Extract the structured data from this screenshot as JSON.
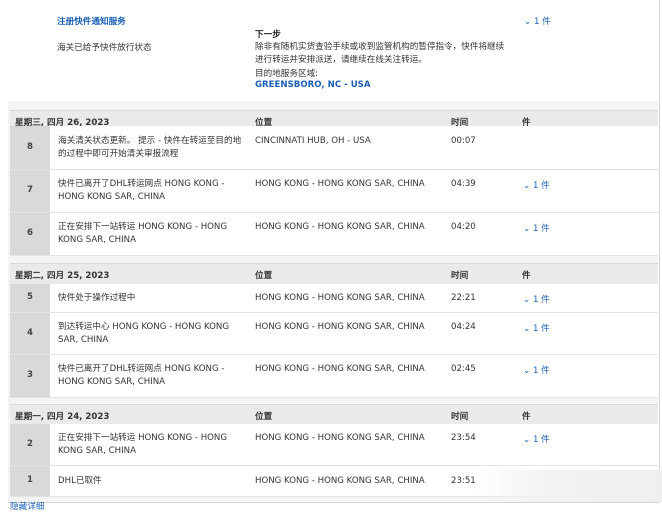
{
  "top": {
    "register_link": "注册快件通知服务",
    "pieces_toggle": "1 件",
    "status_text": "海关已给予快件放行状态",
    "next_step_title": "下一步",
    "next_step_body": "除非有随机实货查验手续或收到监管机构的暂停指令，快件将继续进行转运并安排派送，请继续在线关注转运。",
    "destination_label": "目的地服务区域:",
    "destination_value": "GREENSBORO, NC - USA"
  },
  "columns": {
    "location": "位置",
    "time": "时间",
    "pieces": "件"
  },
  "days": [
    {
      "date": "星期三, 四月 26, 2023",
      "events": [
        {
          "n": "8",
          "desc": "海关清关状态更新。 提示 - 快件在转运至目的地的过程中即可开始清关审报流程",
          "loc": "CINCINNATI HUB, OH - USA",
          "time": "00:07",
          "pcs": ""
        },
        {
          "n": "7",
          "desc": "快件已离开了DHL转运网点 HONG KONG - HONG KONG SAR, CHINA",
          "loc": "HONG KONG - HONG KONG SAR, CHINA",
          "time": "04:39",
          "pcs": "1 件"
        },
        {
          "n": "6",
          "desc": "正在安排下一站转运 HONG KONG - HONG KONG SAR, CHINA",
          "loc": "HONG KONG - HONG KONG SAR, CHINA",
          "time": "04:20",
          "pcs": "1 件"
        }
      ]
    },
    {
      "date": "星期二, 四月 25, 2023",
      "events": [
        {
          "n": "5",
          "desc": "快件处于操作过程中",
          "loc": "HONG KONG - HONG KONG SAR, CHINA",
          "time": "22:21",
          "pcs": "1 件"
        },
        {
          "n": "4",
          "desc": "到达转运中心 HONG KONG - HONG KONG SAR, CHINA",
          "loc": "HONG KONG - HONG KONG SAR, CHINA",
          "time": "04:24",
          "pcs": "1 件"
        },
        {
          "n": "3",
          "desc": "快件已离开了DHL转运网点 HONG KONG - HONG KONG SAR, CHINA",
          "loc": "HONG KONG - HONG KONG SAR, CHINA",
          "time": "02:45",
          "pcs": "1 件"
        }
      ]
    },
    {
      "date": "星期一, 四月 24, 2023",
      "events": [
        {
          "n": "2",
          "desc": "正在安排下一站转运 HONG KONG - HONG KONG SAR, CHINA",
          "loc": "HONG KONG - HONG KONG SAR, CHINA",
          "time": "23:54",
          "pcs": "1 件"
        },
        {
          "n": "1",
          "desc": "DHL已取件",
          "loc": "HONG KONG - HONG KONG SAR, CHINA",
          "time": "23:51",
          "pcs": ""
        }
      ]
    }
  ],
  "hide_details": "隐藏详细"
}
